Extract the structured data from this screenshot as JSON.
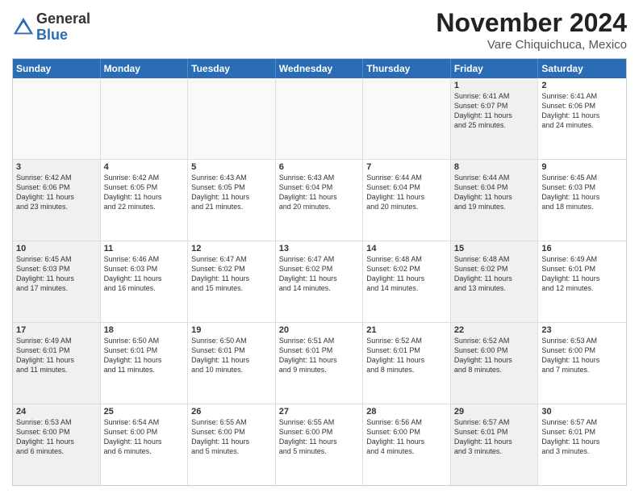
{
  "logo": {
    "general": "General",
    "blue": "Blue"
  },
  "title": "November 2024",
  "location": "Vare Chiquichuca, Mexico",
  "header_days": [
    "Sunday",
    "Monday",
    "Tuesday",
    "Wednesday",
    "Thursday",
    "Friday",
    "Saturday"
  ],
  "rows": [
    [
      {
        "day": "",
        "info": "",
        "empty": true
      },
      {
        "day": "",
        "info": "",
        "empty": true
      },
      {
        "day": "",
        "info": "",
        "empty": true
      },
      {
        "day": "",
        "info": "",
        "empty": true
      },
      {
        "day": "",
        "info": "",
        "empty": true
      },
      {
        "day": "1",
        "info": "Sunrise: 6:41 AM\nSunset: 6:07 PM\nDaylight: 11 hours\nand 25 minutes.",
        "shaded": true
      },
      {
        "day": "2",
        "info": "Sunrise: 6:41 AM\nSunset: 6:06 PM\nDaylight: 11 hours\nand 24 minutes.",
        "shaded": false
      }
    ],
    [
      {
        "day": "3",
        "info": "Sunrise: 6:42 AM\nSunset: 6:06 PM\nDaylight: 11 hours\nand 23 minutes.",
        "shaded": true
      },
      {
        "day": "4",
        "info": "Sunrise: 6:42 AM\nSunset: 6:05 PM\nDaylight: 11 hours\nand 22 minutes.",
        "shaded": false
      },
      {
        "day": "5",
        "info": "Sunrise: 6:43 AM\nSunset: 6:05 PM\nDaylight: 11 hours\nand 21 minutes.",
        "shaded": false
      },
      {
        "day": "6",
        "info": "Sunrise: 6:43 AM\nSunset: 6:04 PM\nDaylight: 11 hours\nand 20 minutes.",
        "shaded": false
      },
      {
        "day": "7",
        "info": "Sunrise: 6:44 AM\nSunset: 6:04 PM\nDaylight: 11 hours\nand 20 minutes.",
        "shaded": false
      },
      {
        "day": "8",
        "info": "Sunrise: 6:44 AM\nSunset: 6:04 PM\nDaylight: 11 hours\nand 19 minutes.",
        "shaded": true
      },
      {
        "day": "9",
        "info": "Sunrise: 6:45 AM\nSunset: 6:03 PM\nDaylight: 11 hours\nand 18 minutes.",
        "shaded": false
      }
    ],
    [
      {
        "day": "10",
        "info": "Sunrise: 6:45 AM\nSunset: 6:03 PM\nDaylight: 11 hours\nand 17 minutes.",
        "shaded": true
      },
      {
        "day": "11",
        "info": "Sunrise: 6:46 AM\nSunset: 6:03 PM\nDaylight: 11 hours\nand 16 minutes.",
        "shaded": false
      },
      {
        "day": "12",
        "info": "Sunrise: 6:47 AM\nSunset: 6:02 PM\nDaylight: 11 hours\nand 15 minutes.",
        "shaded": false
      },
      {
        "day": "13",
        "info": "Sunrise: 6:47 AM\nSunset: 6:02 PM\nDaylight: 11 hours\nand 14 minutes.",
        "shaded": false
      },
      {
        "day": "14",
        "info": "Sunrise: 6:48 AM\nSunset: 6:02 PM\nDaylight: 11 hours\nand 14 minutes.",
        "shaded": false
      },
      {
        "day": "15",
        "info": "Sunrise: 6:48 AM\nSunset: 6:02 PM\nDaylight: 11 hours\nand 13 minutes.",
        "shaded": true
      },
      {
        "day": "16",
        "info": "Sunrise: 6:49 AM\nSunset: 6:01 PM\nDaylight: 11 hours\nand 12 minutes.",
        "shaded": false
      }
    ],
    [
      {
        "day": "17",
        "info": "Sunrise: 6:49 AM\nSunset: 6:01 PM\nDaylight: 11 hours\nand 11 minutes.",
        "shaded": true
      },
      {
        "day": "18",
        "info": "Sunrise: 6:50 AM\nSunset: 6:01 PM\nDaylight: 11 hours\nand 11 minutes.",
        "shaded": false
      },
      {
        "day": "19",
        "info": "Sunrise: 6:50 AM\nSunset: 6:01 PM\nDaylight: 11 hours\nand 10 minutes.",
        "shaded": false
      },
      {
        "day": "20",
        "info": "Sunrise: 6:51 AM\nSunset: 6:01 PM\nDaylight: 11 hours\nand 9 minutes.",
        "shaded": false
      },
      {
        "day": "21",
        "info": "Sunrise: 6:52 AM\nSunset: 6:01 PM\nDaylight: 11 hours\nand 8 minutes.",
        "shaded": false
      },
      {
        "day": "22",
        "info": "Sunrise: 6:52 AM\nSunset: 6:00 PM\nDaylight: 11 hours\nand 8 minutes.",
        "shaded": true
      },
      {
        "day": "23",
        "info": "Sunrise: 6:53 AM\nSunset: 6:00 PM\nDaylight: 11 hours\nand 7 minutes.",
        "shaded": false
      }
    ],
    [
      {
        "day": "24",
        "info": "Sunrise: 6:53 AM\nSunset: 6:00 PM\nDaylight: 11 hours\nand 6 minutes.",
        "shaded": true
      },
      {
        "day": "25",
        "info": "Sunrise: 6:54 AM\nSunset: 6:00 PM\nDaylight: 11 hours\nand 6 minutes.",
        "shaded": false
      },
      {
        "day": "26",
        "info": "Sunrise: 6:55 AM\nSunset: 6:00 PM\nDaylight: 11 hours\nand 5 minutes.",
        "shaded": false
      },
      {
        "day": "27",
        "info": "Sunrise: 6:55 AM\nSunset: 6:00 PM\nDaylight: 11 hours\nand 5 minutes.",
        "shaded": false
      },
      {
        "day": "28",
        "info": "Sunrise: 6:56 AM\nSunset: 6:00 PM\nDaylight: 11 hours\nand 4 minutes.",
        "shaded": false
      },
      {
        "day": "29",
        "info": "Sunrise: 6:57 AM\nSunset: 6:01 PM\nDaylight: 11 hours\nand 3 minutes.",
        "shaded": true
      },
      {
        "day": "30",
        "info": "Sunrise: 6:57 AM\nSunset: 6:01 PM\nDaylight: 11 hours\nand 3 minutes.",
        "shaded": false
      }
    ]
  ]
}
